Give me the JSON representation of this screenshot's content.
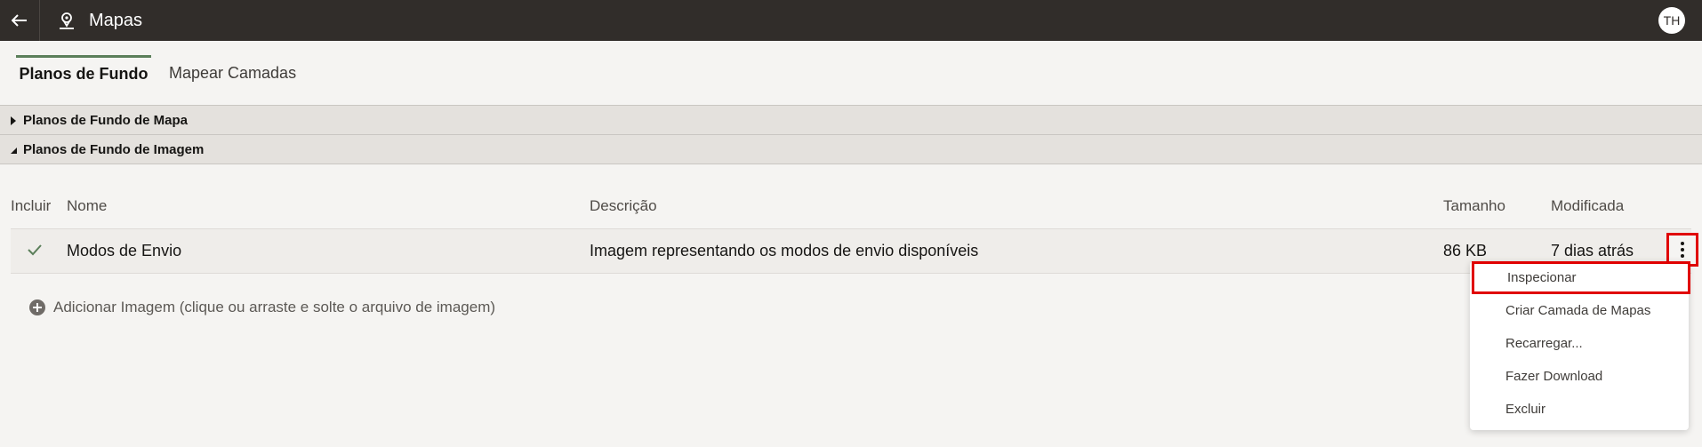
{
  "header": {
    "title": "Mapas",
    "avatar_initials": "TH",
    "bg_color": "#312d2a"
  },
  "tabs": [
    {
      "label": "Planos de Fundo",
      "active": true
    },
    {
      "label": "Mapear Camadas",
      "active": false
    }
  ],
  "sections": [
    {
      "label": "Planos de Fundo de Mapa",
      "expanded": false
    },
    {
      "label": "Planos de Fundo de Imagem",
      "expanded": true
    }
  ],
  "table": {
    "headers": [
      "Incluir",
      "Nome",
      "Descrição",
      "Tamanho",
      "Modificada"
    ],
    "rows": [
      {
        "included": true,
        "name": "Modos de Envio",
        "description": "Imagem representando os modos de envio disponíveis",
        "size": "86 KB",
        "modified": "7 dias atrás"
      }
    ]
  },
  "add_image": {
    "label": "Adicionar Imagem (clique ou arraste e solte o arquivo de imagem)"
  },
  "context_menu": {
    "items": [
      "Inspecionar",
      "Criar Camada de Mapas",
      "Recarregar...",
      "Fazer Download",
      "Excluir"
    ],
    "highlighted": "Inspecionar"
  },
  "colors": {
    "accent_green": "#5b7f5a",
    "highlight_red": "#e00000"
  },
  "icons": {
    "back": "arrow-left-icon",
    "app": "map-pin-icon",
    "included": "check-icon",
    "more": "kebab-menu-icon",
    "add": "plus-circle-icon"
  }
}
